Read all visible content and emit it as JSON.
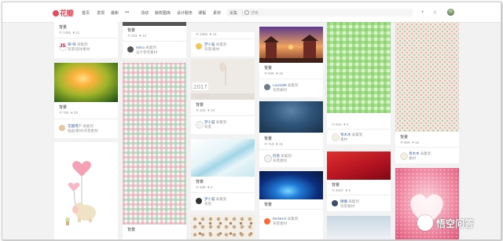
{
  "header": {
    "logo_text": "花瓣",
    "nav": [
      "首页",
      "发现",
      "最新",
      "•••",
      "活动",
      "版权图库",
      "设计服务",
      "课程",
      "素材"
    ],
    "search_category": "采集",
    "search_placeholder": "搜索",
    "icons": [
      "add-icon",
      "bell-icon",
      "message-icon"
    ]
  },
  "colors": {
    "brand": "#e54c5c",
    "link": "#4a6fa5"
  },
  "pins": [
    {
      "id": "c1a",
      "title": "背景",
      "repins": "1456",
      "likes": "11",
      "user": "黄*梓",
      "board": "采集到",
      "board_name": "背景/底纹素材"
    },
    {
      "id": "c1b",
      "title": "背景",
      "repins": "786",
      "likes": "20",
      "user": "花瓣用户",
      "board": "采集到",
      "board_name": "插画/素材/背景素材"
    },
    {
      "id": "c2a",
      "title": "背景",
      "repins": "333",
      "likes": "12",
      "user": "Mimo",
      "board": "采集到",
      "board_name": "设计参考素材"
    },
    {
      "id": "c2b",
      "title": "背景",
      "repins": "",
      "likes": "",
      "user": "",
      "board": "",
      "board_name": ""
    },
    {
      "id": "c3a",
      "title": "",
      "repins": "1566",
      "likes": "41",
      "user": "梦小猫",
      "board": "采集到",
      "board_name": "背景/素材"
    },
    {
      "id": "c3b",
      "title": "背景",
      "repins": "326",
      "likes": "10",
      "user": "梦小猫",
      "board": "采集到",
      "board_name": "背景"
    },
    {
      "id": "c3c",
      "title": "背景",
      "repins": "498",
      "likes": "2",
      "user": "梦小猫",
      "board": "采集到",
      "board_name": "背景"
    },
    {
      "id": "c4a",
      "title": "背景",
      "repins": "609",
      "likes": "15",
      "user": "Laurel88",
      "board": "采集到",
      "board_name": "背景素材"
    },
    {
      "id": "c4b",
      "title": "背景",
      "repins": "718",
      "likes": "15",
      "user": "阿香",
      "board": "采集到",
      "board_name": "背景素材"
    },
    {
      "id": "c4c",
      "title": "背景",
      "repins": "",
      "likes": "",
      "user": "MANHAI",
      "board": "采集到",
      "board_name": "背景素材"
    },
    {
      "id": "c5a",
      "title": "背景",
      "repins": "934",
      "likes": "2",
      "user": "青木木",
      "board": "采集到",
      "board_name": "素材"
    },
    {
      "id": "c5b",
      "title": "背景",
      "repins": "3037",
      "likes": "8",
      "user": "懒懒",
      "board": "采集到",
      "board_name": "背景素材"
    },
    {
      "id": "c6a",
      "title": "背景",
      "repins": "809",
      "likes": "16",
      "user": "青木木",
      "board": "采集到",
      "board_name": "素材"
    }
  ],
  "watermark": "悟空问答"
}
